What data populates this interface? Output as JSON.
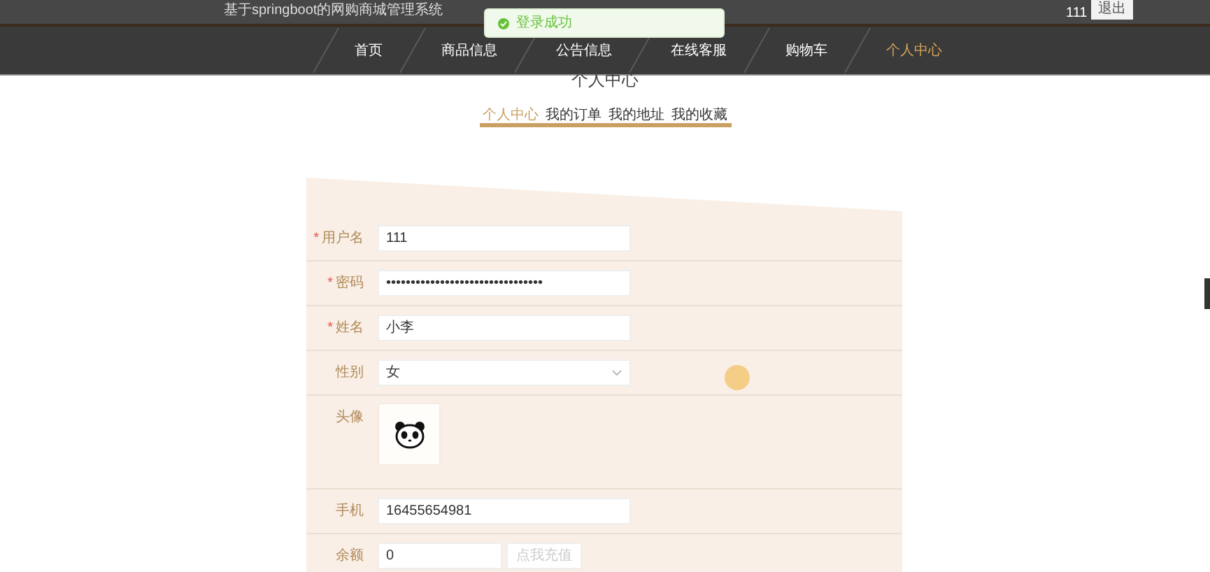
{
  "header": {
    "title": "基于springboot的网购商城管理系统",
    "user": "111",
    "logout": "退出"
  },
  "toast": {
    "message": "登录成功"
  },
  "nav": [
    {
      "label": "首页",
      "selected": false
    },
    {
      "label": "商品信息",
      "selected": false
    },
    {
      "label": "公告信息",
      "selected": false
    },
    {
      "label": "在线客服",
      "selected": false
    },
    {
      "label": "购物车",
      "selected": false
    },
    {
      "label": "个人中心",
      "selected": true
    }
  ],
  "page_title": "个人中心",
  "tabs": [
    {
      "label": "个人中心",
      "selected": true
    },
    {
      "label": "我的订单",
      "selected": false
    },
    {
      "label": "我的地址",
      "selected": false
    },
    {
      "label": "我的收藏",
      "selected": false
    }
  ],
  "form": [
    {
      "kind": "text",
      "label": "用户名",
      "required_mark": "*",
      "value": "111"
    },
    {
      "kind": "text",
      "label": "密码",
      "required_mark": "*",
      "value": "••••••••••••••••••••••••••••••••"
    },
    {
      "kind": "text",
      "label": "姓名",
      "required_mark": "*",
      "value": "小李"
    },
    {
      "kind": "select",
      "label": "性别",
      "value": "女"
    },
    {
      "kind": "avatar",
      "label": "头像"
    },
    {
      "kind": "text",
      "label": "手机",
      "value": "16455654981"
    },
    {
      "kind": "button",
      "label": "余额",
      "value": "0",
      "button": "点我充值"
    }
  ]
}
